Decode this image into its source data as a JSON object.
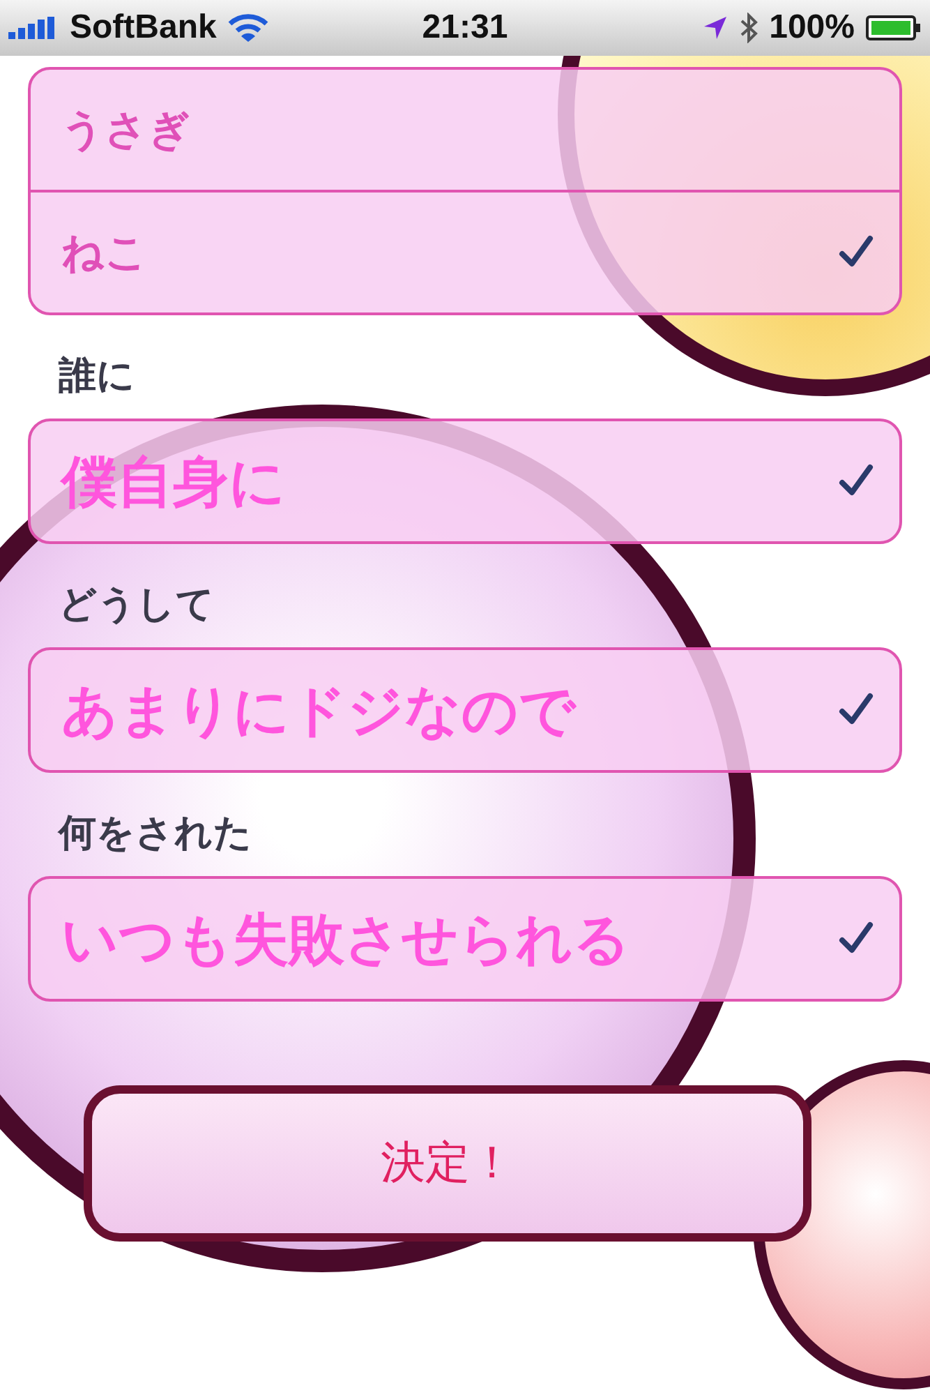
{
  "status_bar": {
    "carrier": "SoftBank",
    "time": "21:31",
    "battery": "100%"
  },
  "sections": [
    {
      "rows": [
        {
          "label": "うさぎ",
          "kind": "option",
          "checked": false
        },
        {
          "label": "ねこ",
          "kind": "option",
          "checked": true
        }
      ]
    },
    {
      "header": "誰に",
      "rows": [
        {
          "label": "僕自身に",
          "kind": "answer",
          "checked": true
        }
      ]
    },
    {
      "header": "どうして",
      "rows": [
        {
          "label": "あまりにドジなので",
          "kind": "answer",
          "checked": true
        }
      ]
    },
    {
      "header": "何をされた",
      "rows": [
        {
          "label": "いつも失敗させられる",
          "kind": "answer",
          "checked": true
        }
      ]
    }
  ],
  "button": {
    "label": "決定！"
  }
}
